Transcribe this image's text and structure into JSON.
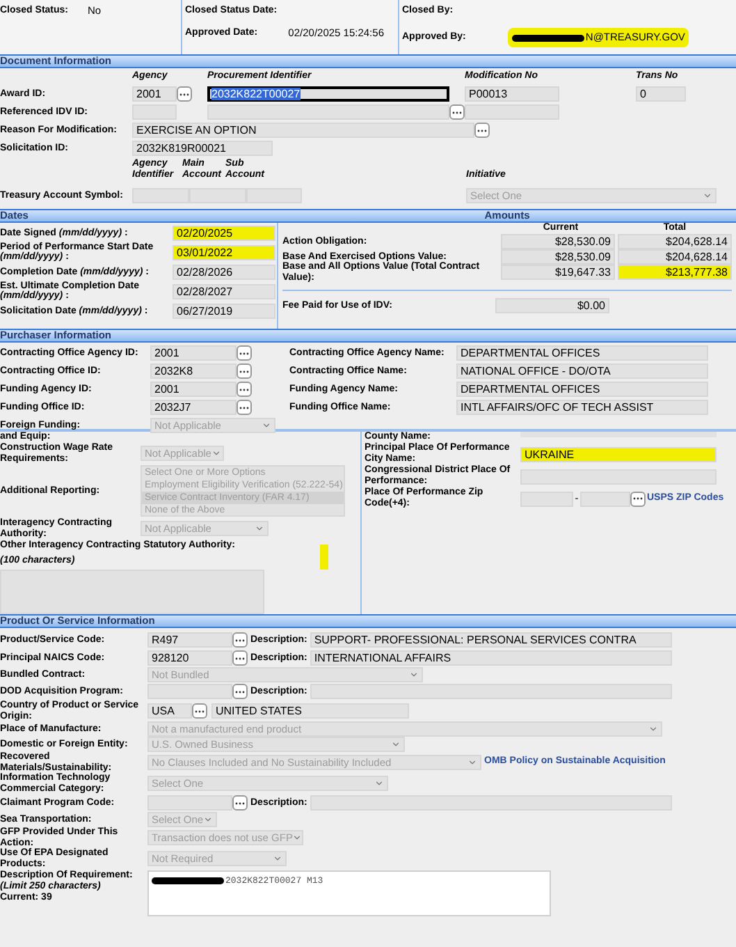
{
  "header": {
    "closed_status": {
      "label": "Closed Status:",
      "value": "No"
    },
    "closed_status_date": {
      "label": "Closed Status Date:"
    },
    "closed_by": {
      "label": "Closed By:"
    },
    "approved_date": {
      "label": "Approved Date:",
      "value": "02/20/2025 15:24:56"
    },
    "approved_by": {
      "label": "Approved By:",
      "value": "N@TREASURY.GOV",
      "redacted": true,
      "highlighted": true
    }
  },
  "document_information": {
    "title": "Document Information",
    "column_headers": [
      "Agency",
      "Procurement Identifier",
      "Modification No",
      "Trans No"
    ],
    "award_id": {
      "label": "Award ID:",
      "agency": "2001",
      "procurement_identifier": "2032K822T00027",
      "procurement_identifier_selected": true,
      "modification_no": "P00013",
      "trans_no": "0"
    },
    "referenced_idv_id": {
      "label": "Referenced IDV ID:"
    },
    "reason_for_modification": {
      "label": "Reason For Modification:",
      "value": "EXERCISE AN OPTION"
    },
    "solicitation_id": {
      "label": "Solicitation ID:",
      "value": "2032K819R00021"
    },
    "account_headers": [
      "Agency Identifier",
      "Main Account",
      "Sub Account"
    ],
    "initiative_header": "Initiative",
    "treasury_account_symbol": {
      "label": "Treasury Account Symbol:",
      "initiative": "Select One"
    }
  },
  "dates": {
    "title": "Dates",
    "rows": [
      {
        "label": "Date Signed *(mm/dd/yyyy)* :",
        "value": "02/20/2025",
        "highlighted": true
      },
      {
        "label": "Period of Performance Start Date *(mm/dd/yyyy)* :",
        "value": "03/01/2022",
        "highlighted": true
      },
      {
        "label": "Completion Date *(mm/dd/yyyy)* :",
        "value": "02/28/2026",
        "highlighted": false
      },
      {
        "label": "Est. Ultimate Completion Date *(mm/dd/yyyy)* :",
        "value": "02/28/2027",
        "highlighted": false
      },
      {
        "label": "Solicitation Date *(mm/dd/yyyy)* :",
        "value": "06/27/2019",
        "highlighted": false
      }
    ]
  },
  "amounts": {
    "title": "Amounts",
    "column_headers": [
      "Current",
      "Total"
    ],
    "rows": [
      {
        "label": "Action Obligation:",
        "current": "$28,530.09",
        "total": "$204,628.14",
        "highlighted": false
      },
      {
        "label": "Base And Exercised Options Value:",
        "current": "$28,530.09",
        "total": "$204,628.14",
        "highlighted": false
      },
      {
        "label": "Base and All Options Value (Total Contract Value):",
        "current": "$19,647.33",
        "total": "$213,777.38",
        "highlighted": true
      }
    ],
    "fee": {
      "label": "Fee Paid for Use of IDV:",
      "current": "$0.00"
    }
  },
  "purchaser_information": {
    "title": "Purchaser Information",
    "rows": [
      {
        "id_label": "Contracting Office Agency ID:",
        "id": "2001",
        "name_label": "Contracting Office Agency Name:",
        "name": "DEPARTMENTAL OFFICES"
      },
      {
        "id_label": "Contracting Office ID:",
        "id": "2032K8",
        "name_label": "Contracting Office Name:",
        "name": "NATIONAL OFFICE - DO/OTA"
      },
      {
        "id_label": "Funding Agency ID:",
        "id": "2001",
        "name_label": "Funding Agency Name:",
        "name": "DEPARTMENTAL OFFICES"
      },
      {
        "id_label": "Funding Office ID:",
        "id": "2032J7",
        "name_label": "Funding Office Name:",
        "name": "INTL AFFAIRS/OFC OF TECH ASSIST"
      }
    ],
    "foreign_funding": {
      "label": "Foreign Funding:",
      "value": "Not Applicable"
    }
  },
  "compliance": {
    "left": {
      "and_equip": {
        "label": "and Equip:"
      },
      "construction_wage": {
        "label": "Construction Wage Rate Requirements:",
        "value": "Not Applicable"
      },
      "additional_reporting": {
        "label": "Additional Reporting:",
        "options": [
          {
            "label": "Select One or More Options",
            "selected": false
          },
          {
            "label": "Employment Eligibility Verification (52.222-54)",
            "selected": false
          },
          {
            "label": "Service Contract Inventory (FAR 4.17)",
            "selected": true
          },
          {
            "label": "None of the Above",
            "selected": false
          }
        ]
      },
      "interagency_authority": {
        "label": "Interagency Contracting Authority:",
        "value": "Not Applicable"
      },
      "other_authority": {
        "label": "Other Interagency Contracting Statutory Authority:",
        "hint": "(100 characters)",
        "highlight_mark": true
      }
    },
    "right": {
      "county": {
        "label": "County Name:"
      },
      "city": {
        "label": "Principal Place Of Performance City Name:",
        "value": "UKRAINE",
        "highlighted": true
      },
      "congressional_district": {
        "label": "Congressional District Place Of Performance:"
      },
      "zip": {
        "label": "Place Of Performance Zip Code(+4):",
        "separator": "-",
        "link": "USPS ZIP Codes"
      }
    }
  },
  "product_or_service_information": {
    "title": "Product Or Service Information",
    "rows": [
      {
        "kind": "lookup",
        "label": "Product/Service Code:",
        "code": "R497",
        "description_label": "Description:",
        "description": "SUPPORT- PROFESSIONAL: PERSONAL SERVICES CONTRA"
      },
      {
        "kind": "lookup",
        "label": "Principal NAICS Code:",
        "code": "928120",
        "description_label": "Description:",
        "description": "INTERNATIONAL AFFAIRS"
      },
      {
        "kind": "select",
        "label": "Bundled Contract:",
        "value": "Not Bundled"
      },
      {
        "kind": "lookup",
        "label": "DOD Acquisition Program:",
        "description_label": "Description:"
      },
      {
        "kind": "country",
        "label": "Country of Product or Service Origin:",
        "code": "USA",
        "description": "UNITED STATES"
      },
      {
        "kind": "select",
        "label": "Place of Manufacture:",
        "value": "Not a manufactured end product"
      },
      {
        "kind": "select",
        "label": "Domestic or Foreign Entity:",
        "value": "U.S. Owned Business"
      },
      {
        "kind": "select",
        "label": "Recovered Materials/Sustainability:",
        "value": "No Clauses Included and No Sustainability Included",
        "link": "OMB Policy on Sustainable Acquisition"
      },
      {
        "kind": "select",
        "label": "Information Technology Commercial Category:",
        "value": "Select One"
      },
      {
        "kind": "lookup",
        "label": "Claimant Program Code:",
        "description_label": "Description:"
      },
      {
        "kind": "select",
        "label": "Sea Transportation:",
        "value": "Select One"
      },
      {
        "kind": "select",
        "label": "GFP Provided Under This Action:",
        "value": "Transaction does not use GFP"
      },
      {
        "kind": "select",
        "label": "Use Of EPA Designated Products:",
        "value": "Not Required"
      },
      {
        "kind": "textarea",
        "label": "Description Of Requirement:",
        "hint": "(Limit 250 characters)",
        "counter": "Current: 39",
        "value": "2032K822T00027 M13",
        "redacted": true
      }
    ]
  }
}
